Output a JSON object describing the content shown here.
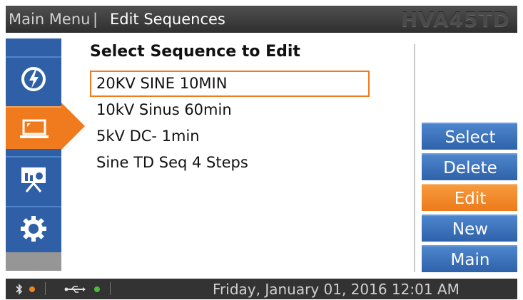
{
  "header": {
    "crumb_main": "Main Menu",
    "separator": "|",
    "crumb_current": "Edit Sequences",
    "model": "HVA45TD"
  },
  "sidebar": {
    "items": [
      {
        "icon": "power-icon",
        "active": false
      },
      {
        "icon": "laptop-icon",
        "active": true
      },
      {
        "icon": "presentation-chart-icon",
        "active": false
      },
      {
        "icon": "gear-icon",
        "active": false
      }
    ]
  },
  "main": {
    "title": "Select Sequence to Edit",
    "sequences": [
      {
        "label": "20KV SINE 10MIN",
        "selected": true
      },
      {
        "label": "10kV Sinus 60min",
        "selected": false
      },
      {
        "label": "5kV DC- 1min",
        "selected": false
      },
      {
        "label": "Sine TD Seq 4 Steps",
        "selected": false
      }
    ]
  },
  "buttons": {
    "select": "Select",
    "delete": "Delete",
    "edit": "Edit",
    "new": "New",
    "main": "Main"
  },
  "status": {
    "bluetooth_icon": "bluetooth-icon",
    "usb_icon": "usb-icon",
    "bluetooth_dot_color": "#f0841e",
    "usb_dot_color": "#4cbb3c",
    "datetime": "Friday, January 01, 2016 12:01 AM"
  },
  "colors": {
    "accent_orange": "#f07a1e",
    "accent_blue": "#2f60a7"
  }
}
